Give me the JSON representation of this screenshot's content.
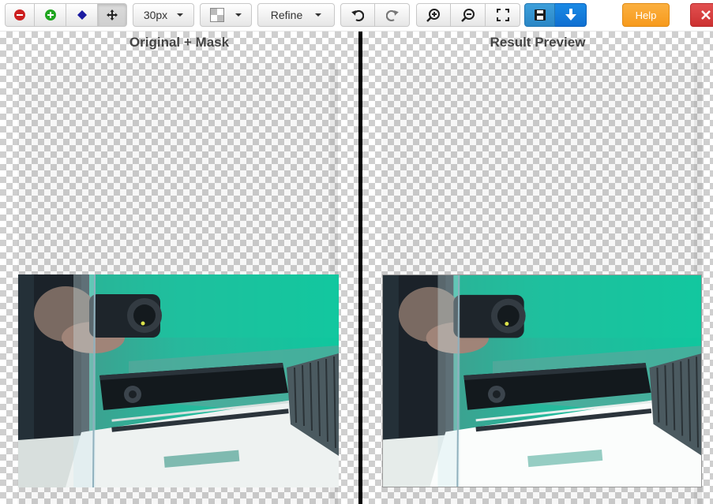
{
  "toolbar": {
    "brush_size": "30px",
    "refine_label": "Refine",
    "help_label": "Help"
  },
  "icons": {
    "remove": "minus-circle-icon",
    "add": "plus-circle-icon",
    "eraser": "eraser-icon",
    "move": "move-icon",
    "background": "background-pattern-icon",
    "undo": "undo-icon",
    "redo": "redo-icon",
    "zoom_in": "zoom-in-icon",
    "zoom_out": "zoom-out-icon",
    "fit": "fit-screen-icon",
    "save": "save-icon",
    "download": "download-icon",
    "close": "close-icon"
  },
  "panels": {
    "left_title": "Original + Mask",
    "right_title": "Result Preview"
  },
  "colors": {
    "remove": "#cc1f1f",
    "add": "#1fa51f",
    "eraser": "#1a1aa0",
    "save_button": "#2a86c5",
    "download_button": "#0f6fd1",
    "help_button": "#f79a1c",
    "close_button": "#cc3131"
  }
}
